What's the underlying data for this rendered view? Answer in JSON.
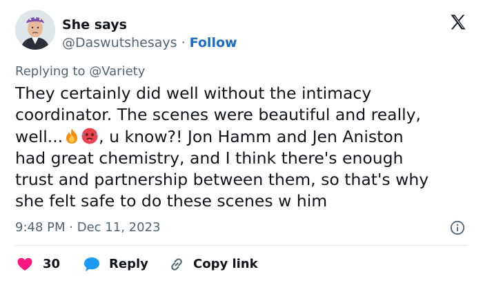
{
  "author": {
    "display_name": "She says",
    "handle": "@Daswutshesays",
    "separator": "·",
    "follow_label": "Follow"
  },
  "reply_context": {
    "prefix": "Replying to",
    "mention": "@Variety"
  },
  "tweet": {
    "lines": [
      "They certainly did well without the intimacy",
      "coordinator. The scenes were beautiful and really,",
      "well...",
      ", u know?! Jon Hamm and Jen Aniston",
      "had great chemistry, and I think there's enough",
      "trust and partnership between them, so that's why",
      "she felt safe to do these scenes w him"
    ],
    "emojis": [
      "fire-emoji",
      "hot-face-emoji"
    ]
  },
  "meta": {
    "time": "9:48 PM",
    "separator": "·",
    "date": "Dec 11, 2023"
  },
  "actions": {
    "like_count": "30",
    "reply_label": "Reply",
    "copy_link_label": "Copy link"
  },
  "colors": {
    "accent_link": "#1d6bc4",
    "like_heart": "#f91880",
    "reply_bubble": "#1d9bf0",
    "muted_text": "#536471",
    "divider": "#e6e9ec"
  },
  "icons": [
    "x-logo-icon",
    "info-icon",
    "heart-icon",
    "reply-bubble-icon",
    "link-icon"
  ]
}
